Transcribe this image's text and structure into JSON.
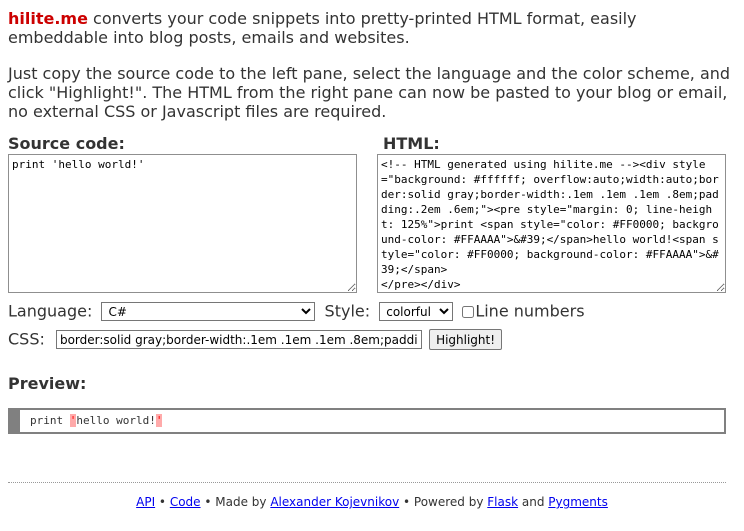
{
  "intro": {
    "brand": "hilite.me",
    "line1_rest": " converts your code snippets into pretty-printed HTML format, easily embeddable into blog posts, emails and websites.",
    "line2": "Just copy the source code to the left pane, select the language and the color scheme, and click \"Highlight!\". The HTML from the right pane can now be pasted to your blog or email, no external CSS or Javascript files are required."
  },
  "source": {
    "label": "Source code:",
    "value": "print 'hello world!'"
  },
  "html": {
    "label": "HTML:",
    "value": "<!-- HTML generated using hilite.me --><div style=\"background: #ffffff; overflow:auto;width:auto;border:solid gray;border-width:.1em .1em .1em .8em;padding:.2em .6em;\"><pre style=\"margin: 0; line-height: 125%\">print <span style=\"color: #FF0000; background-color: #FFAAAA\">&#39;</span>hello world!<span style=\"color: #FF0000; background-color: #FFAAAA\">&#39;</span>\n</pre></div>"
  },
  "options": {
    "language_label": "Language:",
    "language_value": "C#",
    "style_label": "Style:",
    "style_value": "colorful",
    "line_numbers_label": "Line numbers",
    "css_label": "CSS:",
    "css_value": "border:solid gray;border-width:.1em .1em .1em .8em;padding:.2em .6em;",
    "highlight_button": "Highlight!"
  },
  "preview": {
    "label": "Preview:",
    "code_before": "print ",
    "quote_open": "'",
    "code_middle": "hello world!",
    "quote_close": "'"
  },
  "footer": {
    "api": "API",
    "sep1": " • ",
    "code": "Code",
    "made_by": " • Made by ",
    "author": "Alexander Kojevnikov",
    "powered_by": " • Powered by ",
    "flask": "Flask",
    "and": " and ",
    "pygments": "Pygments"
  },
  "colors": {
    "brand": "#cc0000",
    "text": "#333333",
    "link": "#0000ee",
    "preview_border": "#808080",
    "token_error_fg": "#ff0000",
    "token_error_bg": "#ffaaaa"
  }
}
